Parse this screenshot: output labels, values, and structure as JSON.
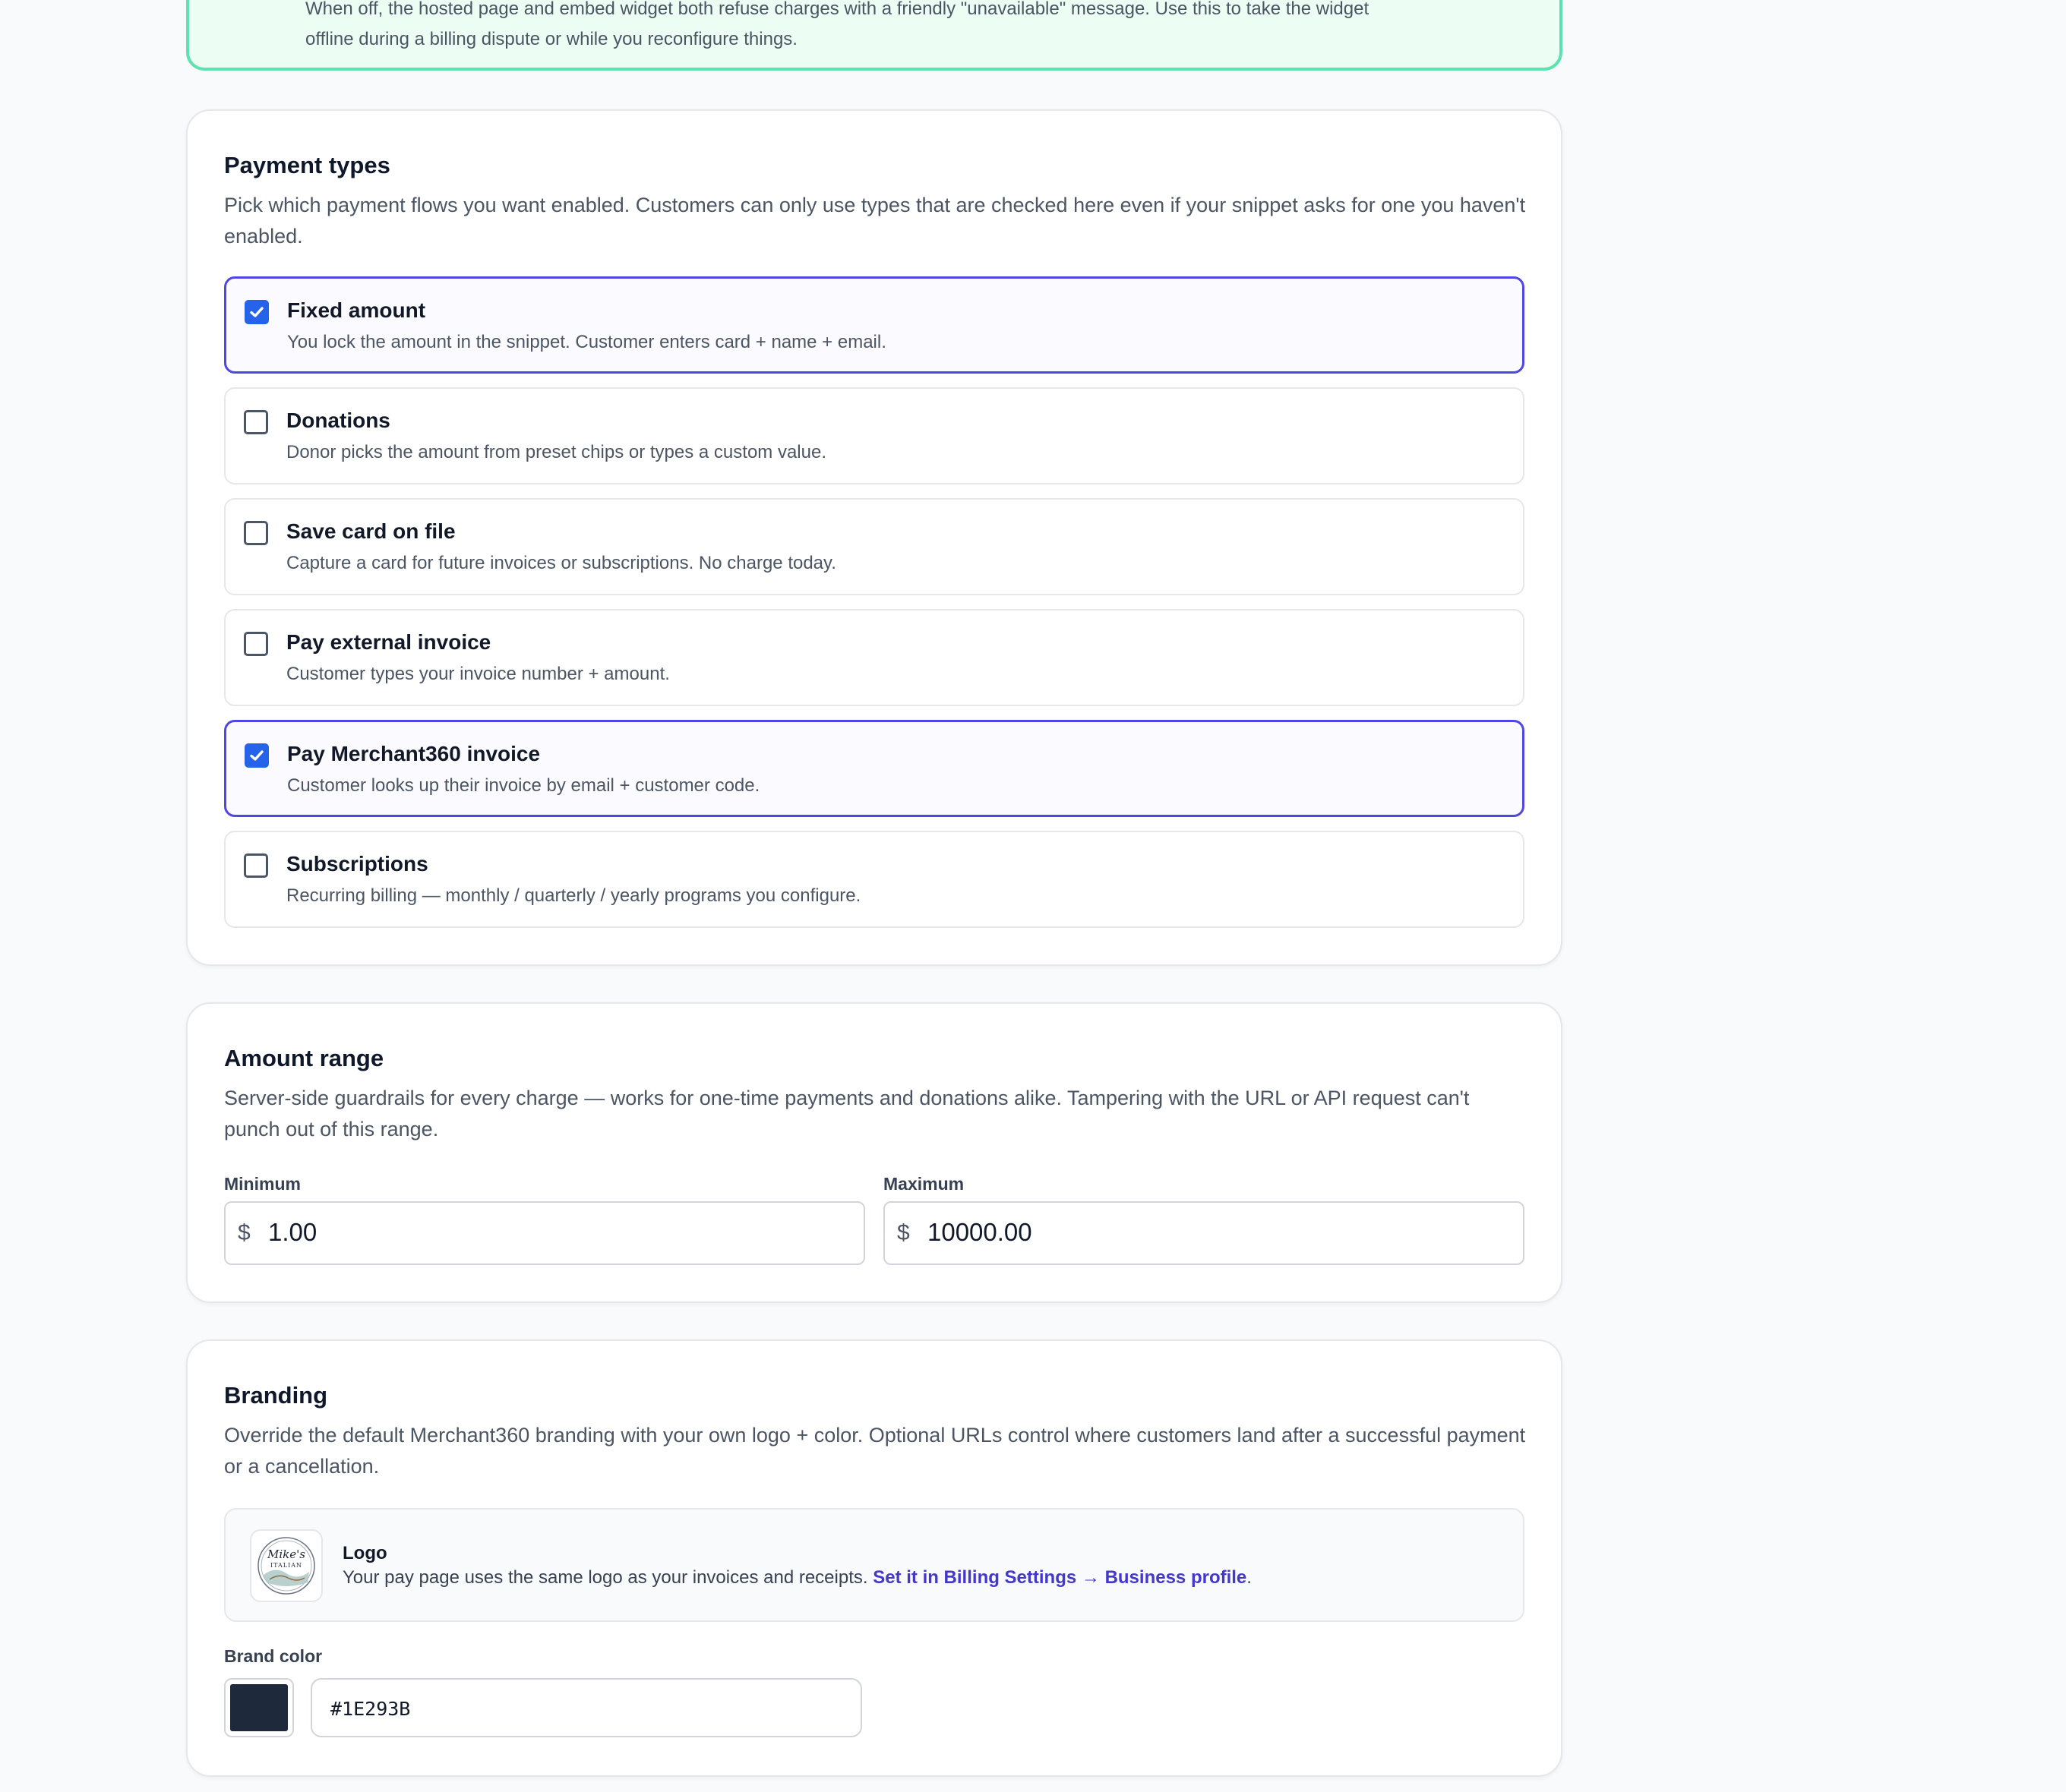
{
  "status_card": {
    "description_line1": "When off, the hosted page and embed widget both refuse charges with a friendly \"unavailable\" message. Use this to take the widget",
    "description_line2": "offline during a billing dispute or while you reconfigure things."
  },
  "payment_types": {
    "title": "Payment types",
    "description": "Pick which payment flows you want enabled. Customers can only use types that are checked here even if your snippet asks for one you haven't enabled.",
    "options": [
      {
        "title": "Fixed amount",
        "description": "You lock the amount in the snippet. Customer enters card + name + email.",
        "checked": true
      },
      {
        "title": "Donations",
        "description": "Donor picks the amount from preset chips or types a custom value.",
        "checked": false
      },
      {
        "title": "Save card on file",
        "description": "Capture a card for future invoices or subscriptions. No charge today.",
        "checked": false
      },
      {
        "title": "Pay external invoice",
        "description": "Customer types your invoice number + amount.",
        "checked": false
      },
      {
        "title": "Pay Merchant360 invoice",
        "description": "Customer looks up their invoice by email + customer code.",
        "checked": true
      },
      {
        "title": "Subscriptions",
        "description": "Recurring billing — monthly / quarterly / yearly programs you configure.",
        "checked": false
      }
    ]
  },
  "amount_range": {
    "title": "Amount range",
    "description": "Server-side guardrails for every charge — works for one-time payments and donations alike. Tampering with the URL or API request can't punch out of this range.",
    "minimum": {
      "label": "Minimum",
      "currency": "$",
      "value": "1.00"
    },
    "maximum": {
      "label": "Maximum",
      "currency": "$",
      "value": "10000.00"
    }
  },
  "branding": {
    "title": "Branding",
    "description": "Override the default Merchant360 branding with your own logo + color. Optional URLs control where customers land after a successful payment or a cancellation.",
    "logo": {
      "title": "Logo",
      "text": "Your pay page uses the same logo as your invoices and receipts.",
      "link": "Set it in Billing Settings → Business profile",
      "period": ".",
      "image_text": "Mike's ITALIAN"
    },
    "brand_color": {
      "label": "Brand color",
      "value": "#1E293B",
      "swatch": "#1E293B"
    }
  },
  "colors": {
    "accent": "#4f46e5",
    "checkbox": "#2563eb",
    "status_border": "#5ee3b0"
  }
}
